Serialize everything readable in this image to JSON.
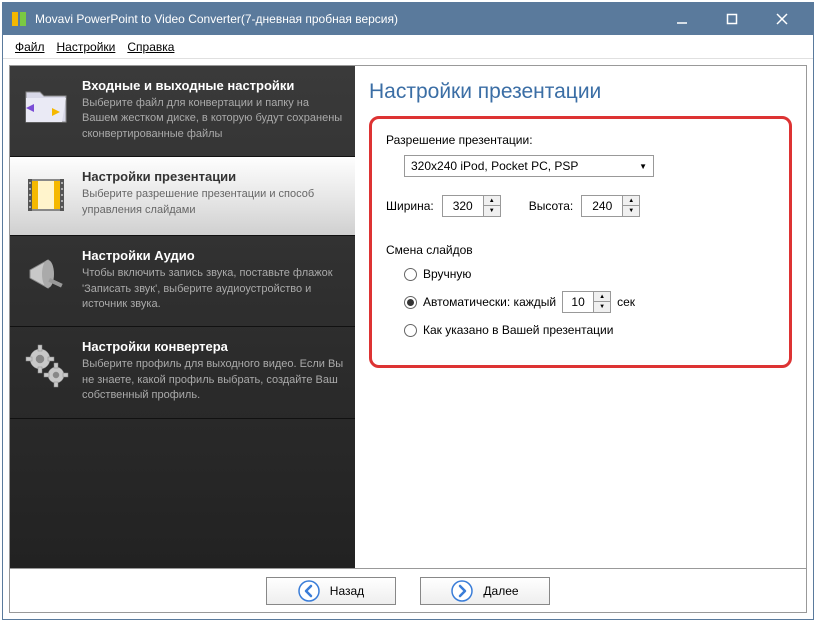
{
  "window": {
    "title": "Movavi PowerPoint to Video Converter(7-дневная пробная версия)"
  },
  "menu": {
    "file": "Файл",
    "settings": "Настройки",
    "help": "Справка"
  },
  "sidebar": {
    "io": {
      "title": "Входные и выходные настройки",
      "desc": "Выберите файл для конвертации и папку на Вашем жестком диске, в которую будут сохранены сконвертированные файлы"
    },
    "presentation": {
      "title": "Настройки презентации",
      "desc": "Выберите разрешение презентации и способ управления слайдами"
    },
    "audio": {
      "title": "Настройки Аудио",
      "desc": "Чтобы включить запись звука, поставьте флажок 'Записать звук', выберите аудиоустройство и источник звука."
    },
    "converter": {
      "title": "Настройки конвертера",
      "desc": "Выберите профиль для выходного видео. Если Вы не знаете, какой профиль выбрать, создайте Ваш собственный профиль."
    }
  },
  "panel": {
    "title": "Настройки презентации",
    "resolution_label": "Разрешение презентации:",
    "resolution_value": "320x240 iPod, Pocket PC, PSP",
    "width_label": "Ширина:",
    "width_value": "320",
    "height_label": "Высота:",
    "height_value": "240",
    "slides_label": "Смена слайдов",
    "manual": "Вручную",
    "auto_prefix": "Автоматически: каждый",
    "auto_value": "10",
    "auto_suffix": "сек",
    "as_specified": "Как указано в Вашей презентации"
  },
  "nav": {
    "back": "Назад",
    "next": "Далее"
  }
}
